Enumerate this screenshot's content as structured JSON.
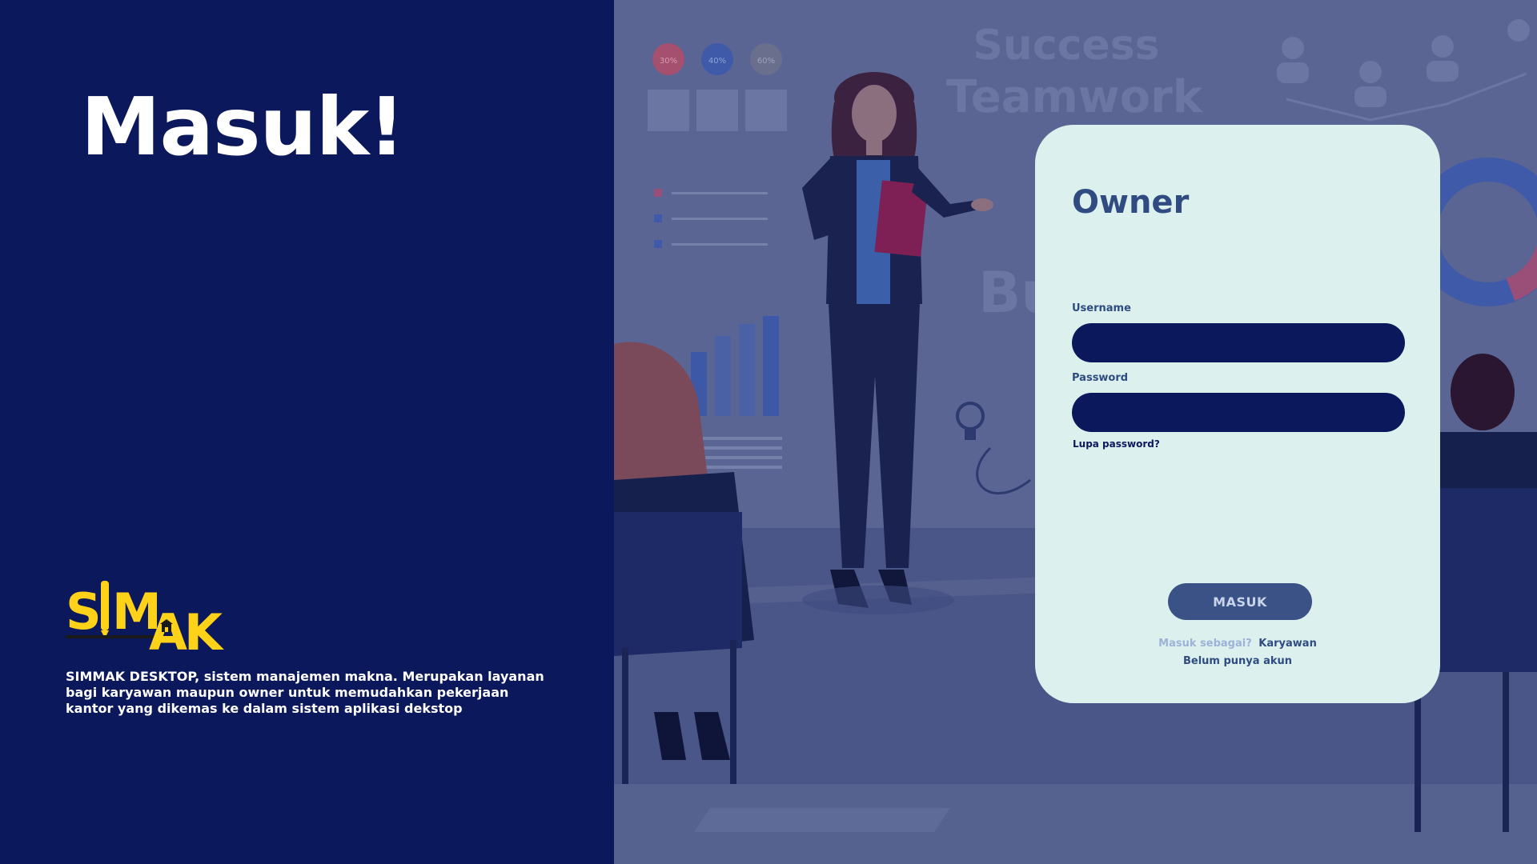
{
  "hero": {
    "title": "Masuk!"
  },
  "brand": {
    "logo_text": "SIMMAK",
    "description": "SIMMAK DESKTOP, sistem manajemen makna.  Merupakan layanan bagi karyawan maupun owner untuk memudahkan pekerjaan kantor yang dikemas ke dalam sistem aplikasi dekstop"
  },
  "background": {
    "board_title_1": "Success",
    "board_title_2": "Teamwork",
    "board_word_partial": "Bu",
    "pin_labels": [
      "30%",
      "40%",
      "60%"
    ]
  },
  "login": {
    "role_title": "Owner",
    "username_label": "Username",
    "username_value": "",
    "password_label": "Password",
    "password_value": "",
    "forgot_password": "Lupa password?",
    "submit_label": "MASUK",
    "switch_role_prompt": "Masuk sebagai?",
    "switch_role_link": "Karyawan",
    "register_link": "Belum punya akun"
  },
  "colors": {
    "left_panel_bg": "#0b185c",
    "card_bg": "#dcf1ee",
    "input_bg": "#0b185c",
    "accent": "#2f4b82",
    "button_bg": "#3b5287",
    "logo_yellow": "#ffd21a"
  }
}
